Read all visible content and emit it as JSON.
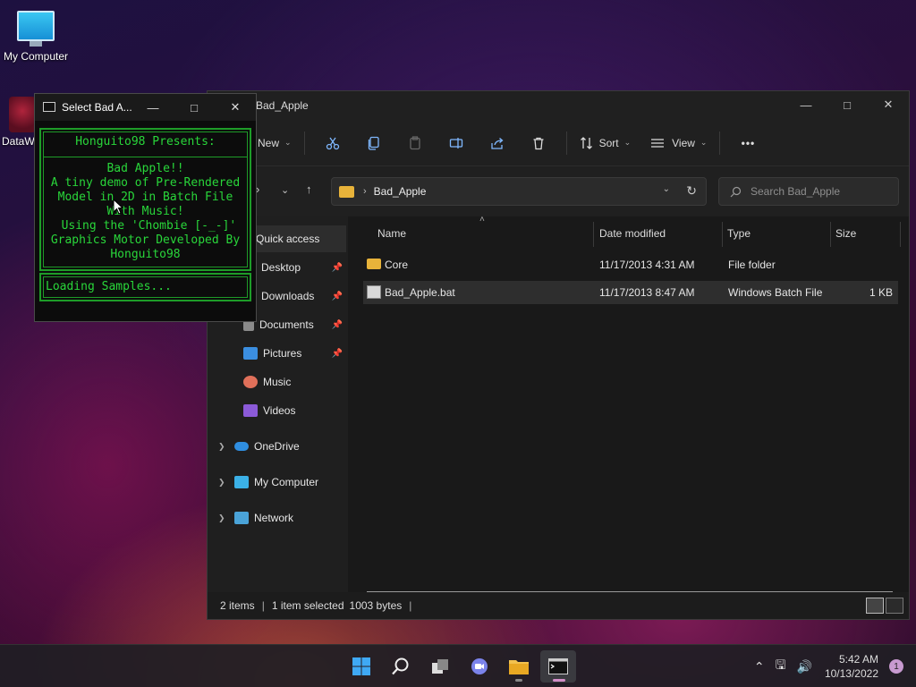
{
  "desktop": {
    "icons": [
      {
        "label": "My Computer"
      },
      {
        "label": "DataW"
      }
    ]
  },
  "explorer": {
    "title": "Bad_Apple",
    "toolbar": {
      "new_label": "New",
      "sort_label": "Sort",
      "view_label": "View",
      "more_label": "•••"
    },
    "address": {
      "path": "Bad_Apple"
    },
    "search": {
      "placeholder": "Search Bad_Apple"
    },
    "nav": {
      "quick_access": "Quick access",
      "desktop": "Desktop",
      "downloads": "Downloads",
      "documents": "Documents",
      "pictures": "Pictures",
      "music": "Music",
      "videos": "Videos",
      "onedrive": "OneDrive",
      "mycomputer": "My Computer",
      "network": "Network"
    },
    "columns": {
      "name": "Name",
      "date": "Date modified",
      "type": "Type",
      "size": "Size"
    },
    "files": [
      {
        "name": "Core",
        "date": "11/17/2013 4:31 AM",
        "type": "File folder",
        "size": ""
      },
      {
        "name": "Bad_Apple.bat",
        "date": "11/17/2013 8:47 AM",
        "type": "Windows Batch File",
        "size": "1 KB"
      }
    ],
    "status": {
      "count": "2 items",
      "selected": "1 item selected",
      "bytes": "1003 bytes"
    }
  },
  "console": {
    "title": "Select Bad A...",
    "header": "Honguito98 Presents:",
    "body_lines": [
      "Bad Apple!!",
      "A tiny demo of Pre-Rendered",
      "Model in 2D in Batch File",
      "With Music!",
      " Using the 'Chombie [-_-]'",
      "Graphics Motor Developed By",
      "Honguito98"
    ],
    "status": "Loading Samples..."
  },
  "taskbar": {
    "time": "5:42 AM",
    "date": "10/13/2022",
    "notifications": "1"
  },
  "colors": {
    "console_green": "#29d63a",
    "folder_yellow": "#e8b33a",
    "accent_pink": "#d38ec8"
  }
}
